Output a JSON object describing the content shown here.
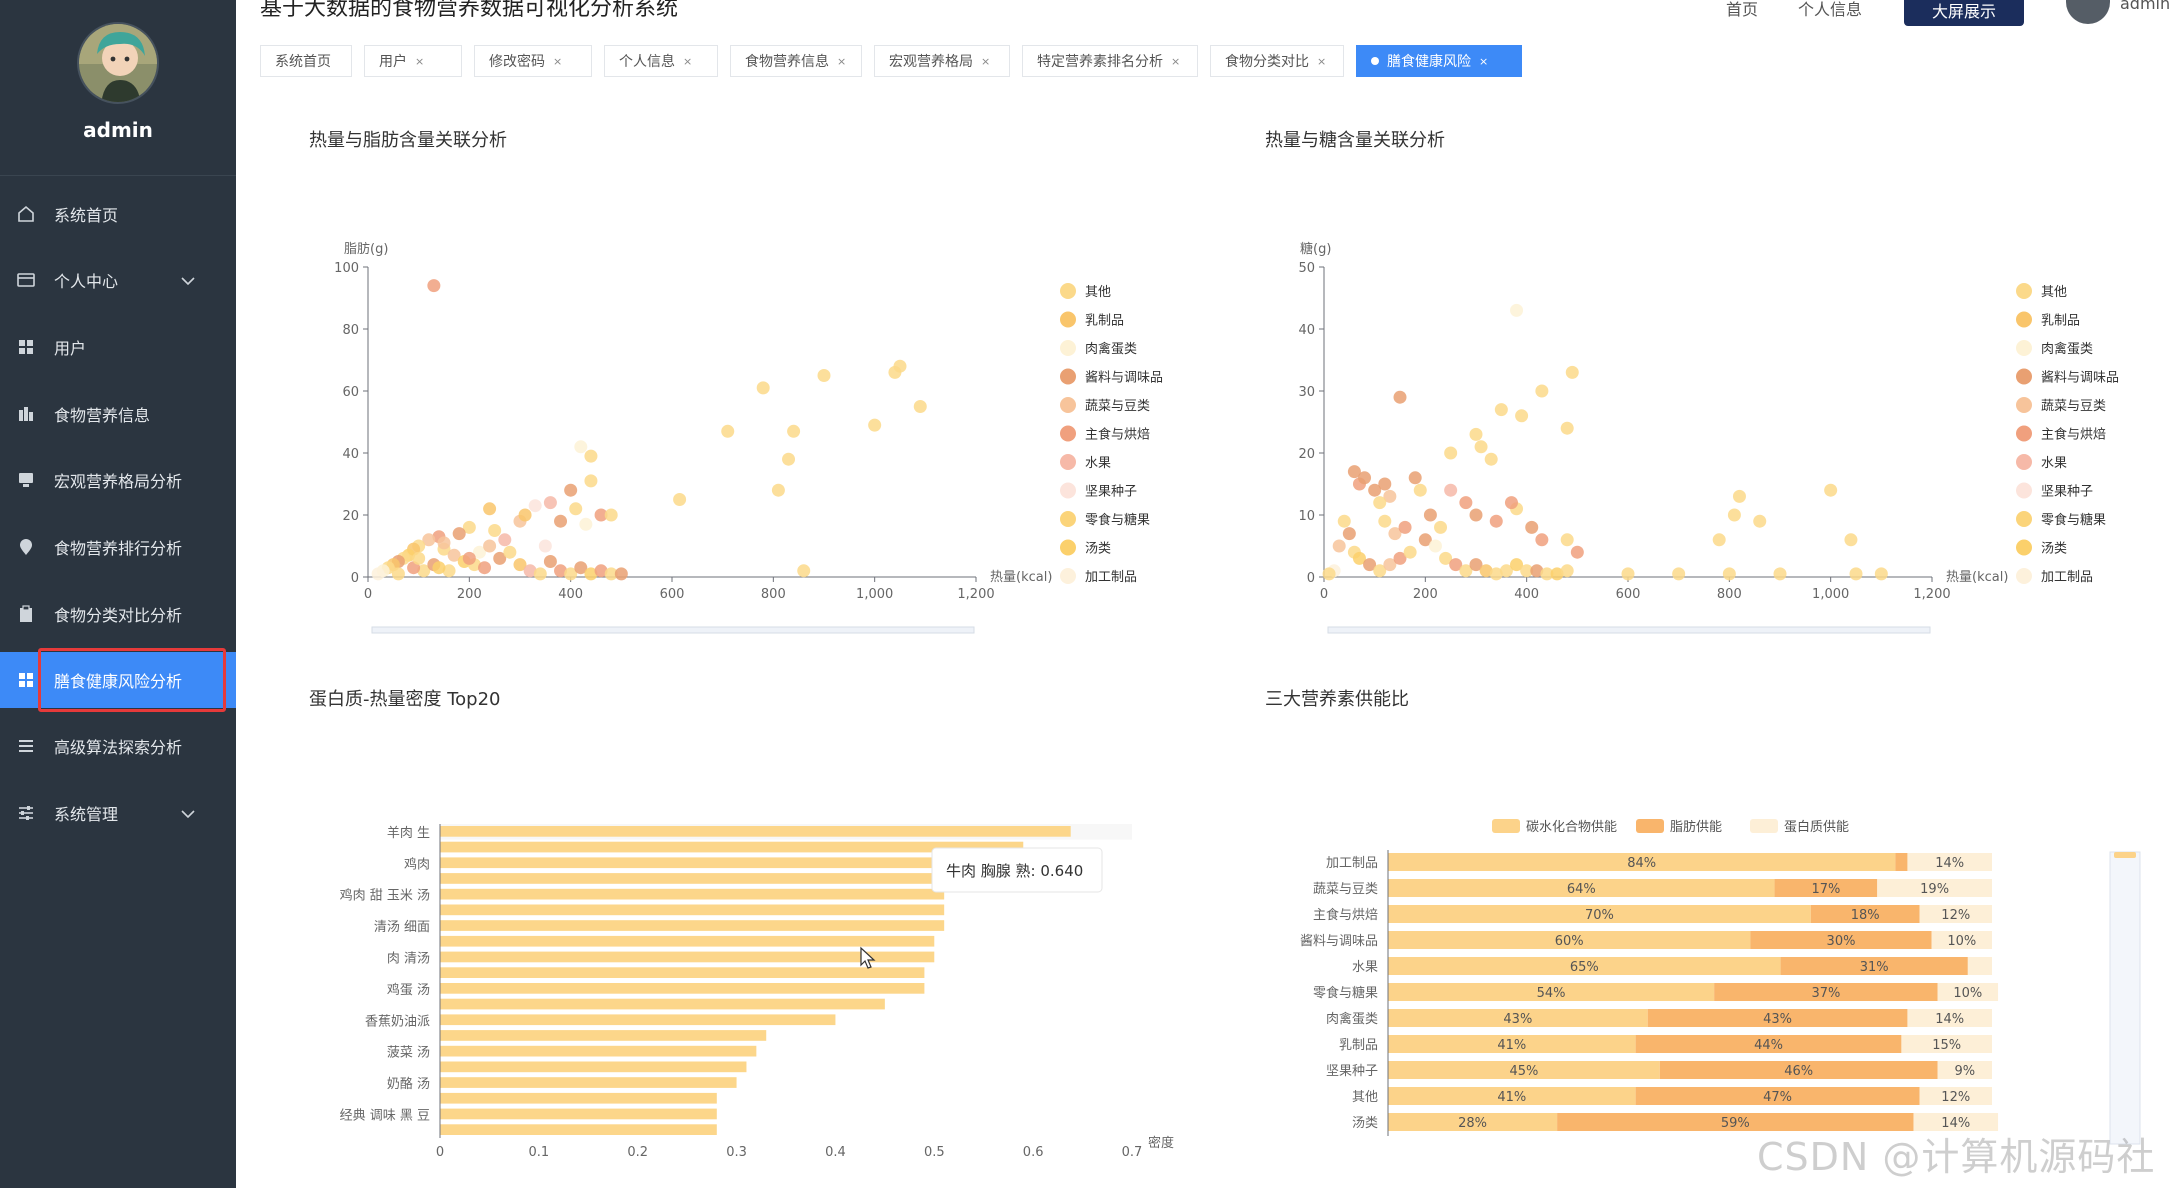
{
  "app": {
    "title": "基于大数据的食物营养数据可视化分析系统",
    "colors": {
      "sidebar_bg": "#2b3540",
      "accent": "#3d8af7",
      "header_btn": "#1b2d5c"
    }
  },
  "sidebar": {
    "username": "admin",
    "items": [
      {
        "label": "系统首页",
        "icon": "home-icon"
      },
      {
        "label": "个人中心",
        "icon": "profile-card-icon",
        "expandable": true
      },
      {
        "label": "用户",
        "icon": "grid-icon"
      },
      {
        "label": "食物营养信息",
        "icon": "bar-chart-icon"
      },
      {
        "label": "宏观营养格局分析",
        "icon": "monitor-icon"
      },
      {
        "label": "食物营养排行分析",
        "icon": "location-pin-icon"
      },
      {
        "label": "食物分类对比分析",
        "icon": "clipboard-icon"
      },
      {
        "label": "膳食健康风险分析",
        "icon": "grid-icon",
        "active": true
      },
      {
        "label": "高级算法探索分析",
        "icon": "list-icon"
      },
      {
        "label": "系统管理",
        "icon": "sliders-icon",
        "expandable": true
      }
    ]
  },
  "header": {
    "links": [
      "首页",
      "个人信息"
    ],
    "big_screen_button": "大屏展示",
    "user": "admin"
  },
  "tabs": [
    {
      "label": "系统首页",
      "closable": false
    },
    {
      "label": "用户",
      "closable": true
    },
    {
      "label": "修改密码",
      "closable": true
    },
    {
      "label": "个人信息",
      "closable": true
    },
    {
      "label": "食物营养信息",
      "closable": true
    },
    {
      "label": "宏观营养格局",
      "closable": true
    },
    {
      "label": "特定营养素排名分析",
      "closable": true
    },
    {
      "label": "食物分类对比",
      "closable": true
    },
    {
      "label": "膳食健康风险",
      "closable": true,
      "active": true
    }
  ],
  "panels": {
    "fat": {
      "title": "热量与脂肪含量关联分析"
    },
    "sugar": {
      "title": "热量与糖含量关联分析"
    },
    "protein": {
      "title": "蛋白质-热量密度 Top20"
    },
    "macro": {
      "title": "三大营养素供能比"
    }
  },
  "legend_categories": [
    "其他",
    "乳制品",
    "肉禽蛋类",
    "酱料与调味品",
    "蔬菜与豆类",
    "主食与烘焙",
    "水果",
    "坚果种子",
    "零食与糖果",
    "汤类",
    "加工制品"
  ],
  "category_colors": [
    "#fbd98a",
    "#f9c56b",
    "#fdf2d6",
    "#e9a072",
    "#f7c49b",
    "#f0a07e",
    "#f6b9a8",
    "#fce4dc",
    "#fbd47a",
    "#fbd06b",
    "#fdf1dc"
  ],
  "chart_data": [
    {
      "type": "scatter",
      "title": "热量与脂肪含量关联分析",
      "xlabel": "热量(kcal)",
      "ylabel": "脂肪(g)",
      "xlim": [
        0,
        1200
      ],
      "ylim": [
        0,
        100
      ],
      "xticks": [
        0,
        200,
        400,
        600,
        800,
        1000,
        1200
      ],
      "yticks": [
        0,
        20,
        40,
        60,
        80,
        100
      ],
      "legend": "right",
      "points": [
        [
          130,
          94,
          5
        ],
        [
          900,
          65,
          0
        ],
        [
          1040,
          66,
          0
        ],
        [
          1050,
          68,
          0
        ],
        [
          780,
          61,
          0
        ],
        [
          1090,
          55,
          0
        ],
        [
          710,
          47,
          0
        ],
        [
          840,
          47,
          0
        ],
        [
          1000,
          49,
          0
        ],
        [
          440,
          39,
          0
        ],
        [
          830,
          38,
          0
        ],
        [
          810,
          28,
          0
        ],
        [
          615,
          25,
          0
        ],
        [
          440,
          31,
          0
        ],
        [
          400,
          28,
          3
        ],
        [
          360,
          24,
          6
        ],
        [
          330,
          23,
          7
        ],
        [
          240,
          22,
          1
        ],
        [
          410,
          22,
          0
        ],
        [
          460,
          20,
          5
        ],
        [
          480,
          20,
          0
        ],
        [
          430,
          17,
          2
        ],
        [
          380,
          18,
          3
        ],
        [
          300,
          18,
          4
        ],
        [
          250,
          15,
          0
        ],
        [
          200,
          16,
          0
        ],
        [
          180,
          14,
          3
        ],
        [
          140,
          13,
          5
        ],
        [
          120,
          12,
          4
        ],
        [
          100,
          10,
          0
        ],
        [
          90,
          9,
          1
        ],
        [
          80,
          7,
          9
        ],
        [
          70,
          6,
          0
        ],
        [
          60,
          5,
          3
        ],
        [
          50,
          4,
          1
        ],
        [
          40,
          3,
          0
        ],
        [
          30,
          2,
          2
        ],
        [
          20,
          1,
          10
        ],
        [
          150,
          9,
          0
        ],
        [
          170,
          7,
          4
        ],
        [
          190,
          5,
          9
        ],
        [
          210,
          4,
          0
        ],
        [
          230,
          3,
          5
        ],
        [
          260,
          6,
          3
        ],
        [
          280,
          8,
          0
        ],
        [
          300,
          4,
          1
        ],
        [
          320,
          2,
          6
        ],
        [
          340,
          1,
          0
        ],
        [
          360,
          5,
          3
        ],
        [
          380,
          2,
          5
        ],
        [
          400,
          1,
          0
        ],
        [
          420,
          3,
          3
        ],
        [
          440,
          1,
          9
        ],
        [
          460,
          2,
          5
        ],
        [
          480,
          1,
          0
        ],
        [
          500,
          1,
          3
        ],
        [
          860,
          2,
          0
        ],
        [
          110,
          2,
          0
        ],
        [
          130,
          4,
          3
        ],
        [
          160,
          2,
          0
        ],
        [
          90,
          3,
          5
        ],
        [
          60,
          1,
          0
        ],
        [
          220,
          8,
          2
        ],
        [
          240,
          10,
          4
        ],
        [
          270,
          12,
          6
        ],
        [
          150,
          11,
          4
        ],
        [
          350,
          10,
          7
        ],
        [
          420,
          42,
          2
        ],
        [
          310,
          20,
          1
        ],
        [
          200,
          6,
          5
        ],
        [
          100,
          6,
          0
        ],
        [
          140,
          3,
          9
        ]
      ]
    },
    {
      "type": "scatter",
      "title": "热量与糖含量关联分析",
      "xlabel": "热量(kcal)",
      "ylabel": "糖(g)",
      "xlim": [
        0,
        1200
      ],
      "ylim": [
        0,
        50
      ],
      "xticks": [
        0,
        200,
        400,
        600,
        800,
        1000,
        1200
      ],
      "yticks": [
        0,
        10,
        20,
        30,
        40,
        50
      ],
      "legend": "right",
      "points": [
        [
          380,
          43,
          2
        ],
        [
          490,
          33,
          0
        ],
        [
          430,
          30,
          0
        ],
        [
          480,
          24,
          0
        ],
        [
          150,
          29,
          3
        ],
        [
          350,
          27,
          0
        ],
        [
          390,
          26,
          0
        ],
        [
          250,
          20,
          0
        ],
        [
          330,
          19,
          0
        ],
        [
          310,
          21,
          0
        ],
        [
          300,
          23,
          0
        ],
        [
          60,
          17,
          3
        ],
        [
          70,
          15,
          5
        ],
        [
          80,
          16,
          3
        ],
        [
          100,
          14,
          3
        ],
        [
          120,
          15,
          3
        ],
        [
          130,
          13,
          4
        ],
        [
          110,
          12,
          0
        ],
        [
          180,
          16,
          3
        ],
        [
          190,
          14,
          0
        ],
        [
          250,
          14,
          6
        ],
        [
          280,
          12,
          5
        ],
        [
          300,
          10,
          3
        ],
        [
          380,
          11,
          0
        ],
        [
          370,
          12,
          5
        ],
        [
          340,
          9,
          5
        ],
        [
          410,
          8,
          3
        ],
        [
          430,
          6,
          5
        ],
        [
          480,
          6,
          0
        ],
        [
          500,
          4,
          5
        ],
        [
          1000,
          14,
          0
        ],
        [
          820,
          13,
          0
        ],
        [
          860,
          9,
          0
        ],
        [
          810,
          10,
          0
        ],
        [
          780,
          6,
          0
        ],
        [
          1040,
          6,
          0
        ],
        [
          40,
          9,
          0
        ],
        [
          50,
          7,
          3
        ],
        [
          30,
          5,
          4
        ],
        [
          60,
          4,
          0
        ],
        [
          70,
          3,
          9
        ],
        [
          90,
          2,
          3
        ],
        [
          110,
          1,
          0
        ],
        [
          130,
          2,
          4
        ],
        [
          150,
          3,
          5
        ],
        [
          170,
          4,
          0
        ],
        [
          200,
          6,
          3
        ],
        [
          220,
          5,
          2
        ],
        [
          240,
          3,
          0
        ],
        [
          260,
          2,
          5
        ],
        [
          280,
          1,
          0
        ],
        [
          300,
          2,
          3
        ],
        [
          320,
          1,
          1
        ],
        [
          340,
          0.5,
          0
        ],
        [
          360,
          1,
          0
        ],
        [
          380,
          2,
          9
        ],
        [
          400,
          1,
          0
        ],
        [
          420,
          1,
          3
        ],
        [
          440,
          0.5,
          0
        ],
        [
          460,
          0.5,
          9
        ],
        [
          480,
          1,
          0
        ],
        [
          600,
          0.5,
          0
        ],
        [
          700,
          0.5,
          0
        ],
        [
          800,
          0.5,
          0
        ],
        [
          900,
          0.5,
          0
        ],
        [
          1050,
          0.5,
          0
        ],
        [
          1100,
          0.5,
          0
        ],
        [
          20,
          1,
          10
        ],
        [
          10,
          0.5,
          0
        ],
        [
          120,
          9,
          0
        ],
        [
          140,
          7,
          4
        ],
        [
          160,
          8,
          5
        ],
        [
          210,
          10,
          3
        ],
        [
          230,
          8,
          0
        ]
      ]
    },
    {
      "type": "bar",
      "orientation": "horizontal",
      "title": "蛋白质-热量密度 Top20",
      "xlabel": "密度",
      "xlim": [
        0,
        0.7
      ],
      "xticks": [
        0,
        0.1,
        0.2,
        0.3,
        0.4,
        0.5,
        0.6,
        0.7
      ],
      "categories": [
        "羊肉 生",
        "",
        "鸡肉",
        "",
        "鸡肉 甜 玉米 汤",
        "",
        "清汤 细面",
        "",
        "肉 清汤",
        "",
        "鸡蛋 汤",
        "",
        "香蕉奶油派",
        "",
        "菠菜 汤",
        "",
        "奶酪 汤",
        "",
        "经典 调味 黑 豆",
        ""
      ],
      "values": [
        0.638,
        0.59,
        0.51,
        0.51,
        0.51,
        0.51,
        0.51,
        0.5,
        0.5,
        0.49,
        0.49,
        0.45,
        0.4,
        0.33,
        0.32,
        0.31,
        0.3,
        0.28,
        0.28,
        0.28
      ],
      "tooltip": "牛肉 胸腺 熟: 0.640"
    },
    {
      "type": "bar",
      "orientation": "horizontal",
      "stacked": true,
      "percent": true,
      "title": "三大营养素供能比",
      "legend": "top",
      "categories": [
        "加工制品",
        "蔬菜与豆类",
        "主食与烘焙",
        "酱料与调味品",
        "水果",
        "零食与糖果",
        "肉禽蛋类",
        "乳制品",
        "坚果种子",
        "其他",
        "汤类"
      ],
      "series": [
        {
          "name": "碳水化合物供能",
          "color": "#fcd38a",
          "values": [
            84,
            64,
            70,
            60,
            65,
            54,
            43,
            41,
            45,
            41,
            28
          ]
        },
        {
          "name": "脂肪供能",
          "color": "#f9b56c",
          "values": [
            2,
            17,
            18,
            30,
            31,
            37,
            43,
            44,
            46,
            47,
            59
          ]
        },
        {
          "name": "蛋白质供能",
          "color": "#fdefd7",
          "values": [
            14,
            19,
            12,
            10,
            4,
            10,
            14,
            15,
            9,
            12,
            14
          ]
        }
      ],
      "labels": [
        [
          "84%",
          "",
          "14%"
        ],
        [
          "64%",
          "17%",
          "19%"
        ],
        [
          "70%",
          "18%",
          "12%"
        ],
        [
          "60%",
          "30%",
          "10%"
        ],
        [
          "65%",
          "31%",
          ""
        ],
        [
          "54%",
          "37%",
          "10%"
        ],
        [
          "43%",
          "43%",
          "14%"
        ],
        [
          "41%",
          "44%",
          "15%"
        ],
        [
          "45%",
          "46%",
          "9%"
        ],
        [
          "41%",
          "47%",
          "12%"
        ],
        [
          "28%",
          "59%",
          "14%"
        ]
      ]
    }
  ],
  "watermark": "CSDN @计算机源码社"
}
